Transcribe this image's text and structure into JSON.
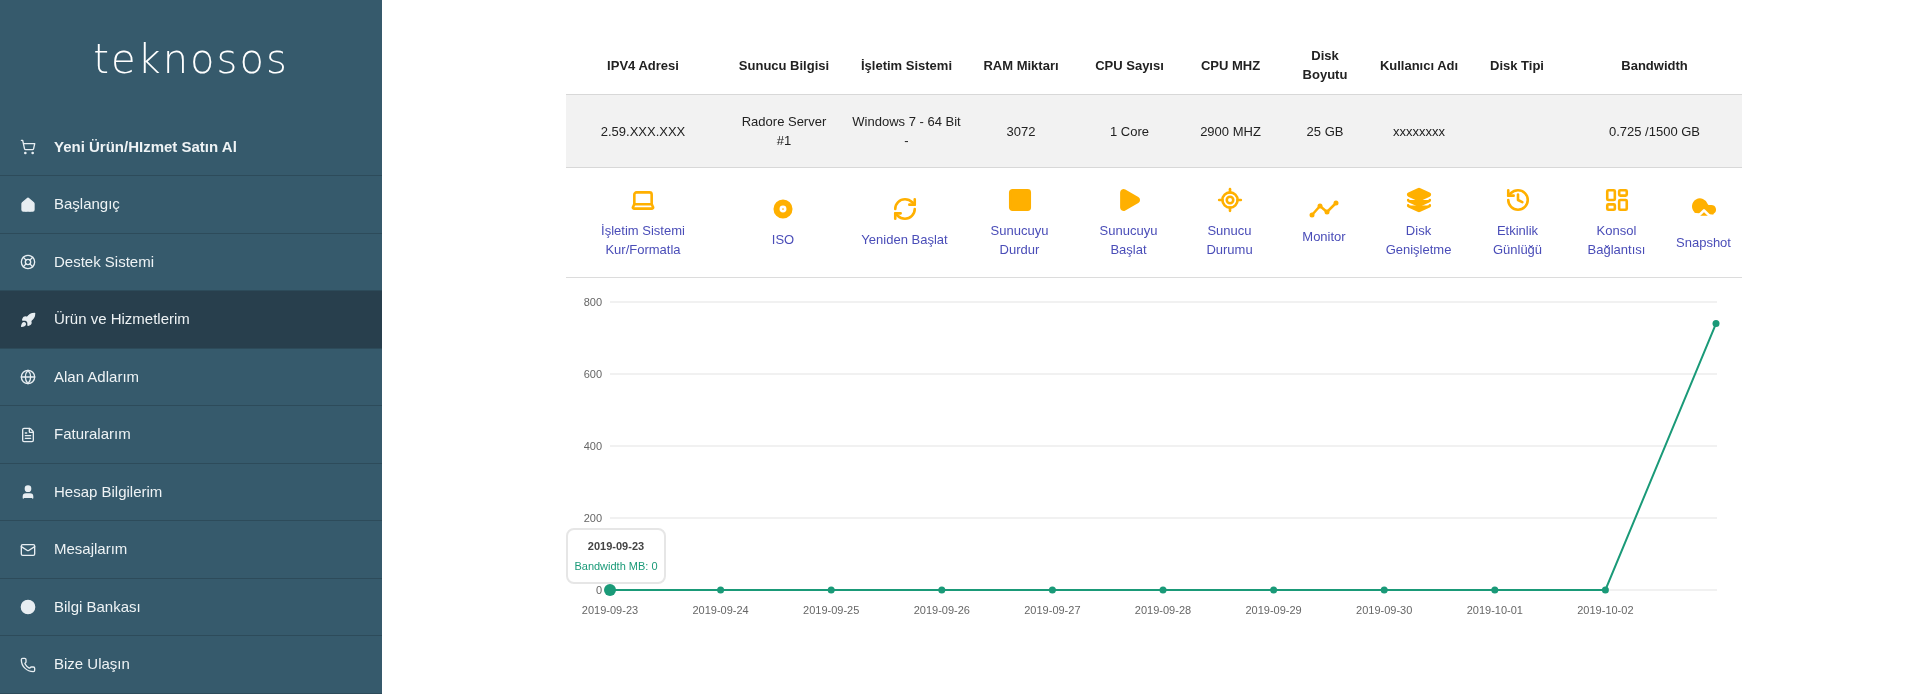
{
  "sidebar": {
    "logo": "teknosos",
    "items": [
      {
        "label": "Yeni Ürün/HIzmet Satın Al",
        "kind": "cta",
        "selected": false
      },
      {
        "label": "Başlangıç",
        "kind": "nav",
        "selected": false
      },
      {
        "label": "Destek Sistemi",
        "kind": "nav",
        "selected": false
      },
      {
        "label": "Ürün ve Hizmetlerim",
        "kind": "nav",
        "selected": true
      },
      {
        "label": "Alan Adlarım",
        "kind": "nav",
        "selected": false
      },
      {
        "label": "Faturalarım",
        "kind": "nav",
        "selected": false
      },
      {
        "label": "Hesap Bilgilerim",
        "kind": "nav",
        "selected": false
      },
      {
        "label": "Mesajlarım",
        "kind": "nav",
        "selected": false
      },
      {
        "label": "Bilgi Bankası",
        "kind": "nav",
        "selected": false
      },
      {
        "label": "Bize Ulaşın",
        "kind": "nav",
        "selected": false
      }
    ]
  },
  "table": {
    "columns": [
      "IPV4 Adresi",
      "Sunucu Bilgisi",
      "İşletim Sistemi",
      "RAM Miktarı",
      "CPU Sayısı",
      "CPU MHZ",
      "Disk\nBoyutu",
      "Kullanıcı Adı",
      "Disk Tipi",
      "Bandwidth"
    ],
    "rows": [
      [
        "2.59.XXX.XXX",
        "Radore Server\n#1",
        "Windows 7 - 64 Bit\n-",
        "3072",
        "1 Core",
        "2900 MHZ",
        "25 GB",
        "xxxxxxxx",
        null,
        "0.725 /1500 GB"
      ]
    ]
  },
  "actions": [
    {
      "label": "İşletim Sistemi\nKur/Formatla"
    },
    {
      "label": "ISO"
    },
    {
      "label": "Yeniden Başlat"
    },
    {
      "label": "Sunucuyu\nDurdur"
    },
    {
      "label": "Sunucuyu\nBaşlat"
    },
    {
      "label": "Sunucu\nDurumu"
    },
    {
      "label": "Monitor"
    },
    {
      "label": "Disk\nGenişletme"
    },
    {
      "label": "Etkinlik\nGünlüğü"
    },
    {
      "label": "Konsol\nBağlantısı"
    },
    {
      "label": "Snapshot"
    }
  ],
  "chart": {
    "tooltip": {
      "title": "2019-09-23",
      "value": ": 0"
    },
    "chart_data": {
      "type": "line",
      "categories": [
        "2019-09-23",
        "2019-09-24",
        "2019-09-25",
        "2019-09-26",
        "2019-09-27",
        "2019-09-28",
        "2019-09-29",
        "2019-09-30",
        "2019-10-01",
        "2019-10-02",
        null
      ],
      "grid": true,
      "series": [
        {
          "name": "Bandwidth MB",
          "color": "#1a9a78",
          "marker": true,
          "values": [
            0,
            0,
            0,
            0,
            0,
            0,
            0,
            0,
            0,
            0,
            740
          ]
        }
      ],
      "ylim": [
        0,
        800
      ],
      "yticks": [
        0,
        200,
        400,
        600,
        800
      ]
    }
  }
}
